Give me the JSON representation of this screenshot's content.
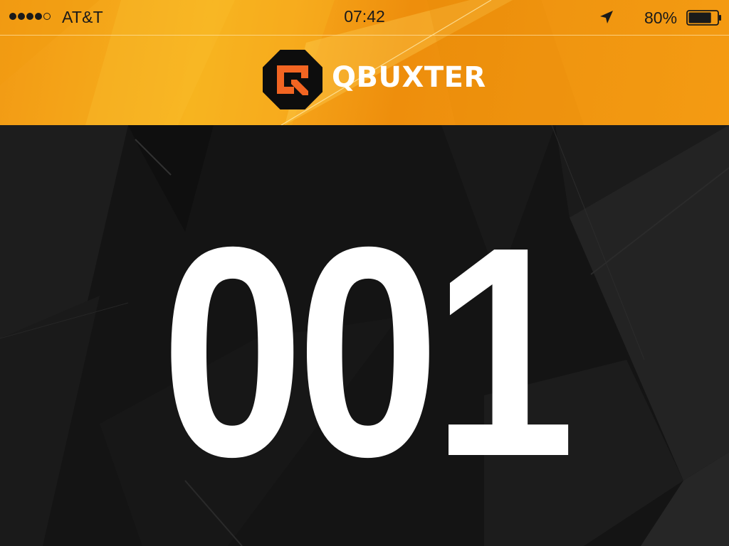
{
  "status_bar": {
    "carrier": "AT&T",
    "signal_bars_filled": 4,
    "signal_bars_total": 5,
    "time": "07:42",
    "battery_percent": "80%",
    "battery_level": 0.8
  },
  "nav_bar": {
    "brand": "QBUXTER",
    "logo_icon": "qbuxter-logo-icon"
  },
  "main": {
    "counter": "001"
  },
  "colors": {
    "accent_orange": "#f29a14",
    "logo_orange": "#f26522",
    "background_dark": "#141414",
    "text_white": "#ffffff"
  }
}
